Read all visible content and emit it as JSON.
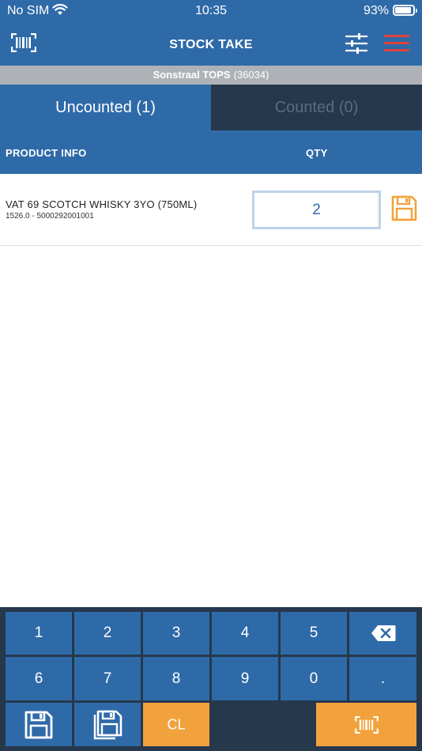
{
  "status_bar": {
    "carrier": "No SIM",
    "time": "10:35",
    "battery_percent": "93%",
    "battery_level": 0.93
  },
  "nav": {
    "title": "STOCK TAKE",
    "icons": [
      "barcode-scan-icon",
      "filter-sliders-icon",
      "hamburger-menu-icon"
    ],
    "menu_color": "#e0413a"
  },
  "store": {
    "name": "Sonstraal TOPS",
    "code": "(36034)"
  },
  "tabs": [
    {
      "label": "Uncounted (1)",
      "active": true
    },
    {
      "label": "Counted (0)",
      "active": false
    }
  ],
  "columns": {
    "product": "PRODUCT INFO",
    "qty": "QTY"
  },
  "items": [
    {
      "name": "VAT 69 SCOTCH WHISKY 3YO (750ML)",
      "code": "1526.0 - 5000292001001",
      "qty": "2"
    }
  ],
  "keypad": {
    "row1": [
      "1",
      "2",
      "3",
      "4",
      "5"
    ],
    "row2": [
      "6",
      "7",
      "8",
      "9",
      "0",
      "."
    ],
    "clear_label": "CL",
    "icons": [
      "backspace-icon",
      "save-icon",
      "save-all-icon",
      "barcode-scan-icon"
    ]
  },
  "colors": {
    "primary": "#2f6aa8",
    "dark": "#25384c",
    "accent": "#f2a23c",
    "store_bar": "#aeb2b7"
  }
}
